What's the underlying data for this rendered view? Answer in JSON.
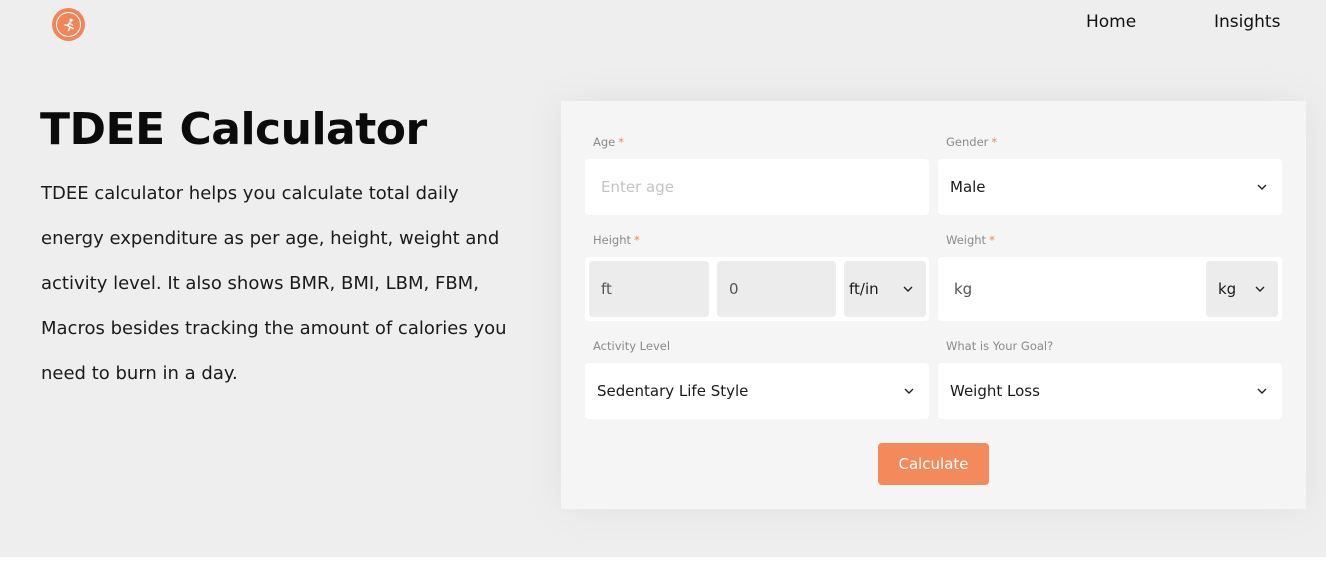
{
  "nav": {
    "home": "Home",
    "insights": "Insights"
  },
  "hero": {
    "title": "TDEE Calculator",
    "description": "TDEE calculator helps you calculate total daily energy expenditure as per age, height, weight and activity level. It also shows BMR, BMI, LBM, FBM, Macros besides tracking the amount of calories you need to burn in a day."
  },
  "form": {
    "age": {
      "label": "Age",
      "required": "*",
      "placeholder": "Enter age"
    },
    "gender": {
      "label": "Gender",
      "required": "*",
      "value": "Male"
    },
    "height": {
      "label": "Height",
      "required": "*",
      "ft_placeholder": "ft",
      "in_value": "0",
      "unit": "ft/in"
    },
    "weight": {
      "label": "Weight",
      "required": "*",
      "placeholder": "kg",
      "unit": "kg"
    },
    "activity": {
      "label": "Activity Level",
      "value": "Sedentary Life Style"
    },
    "goal": {
      "label": "What is Your Goal?",
      "value": "Weight Loss"
    },
    "submit": "Calculate"
  },
  "colors": {
    "accent": "#f4895c",
    "page_bg": "#eeeeee",
    "card_bg": "#f5f5f5"
  },
  "icons": {
    "logo": "runner-icon",
    "dropdown": "chevron-down-icon"
  }
}
